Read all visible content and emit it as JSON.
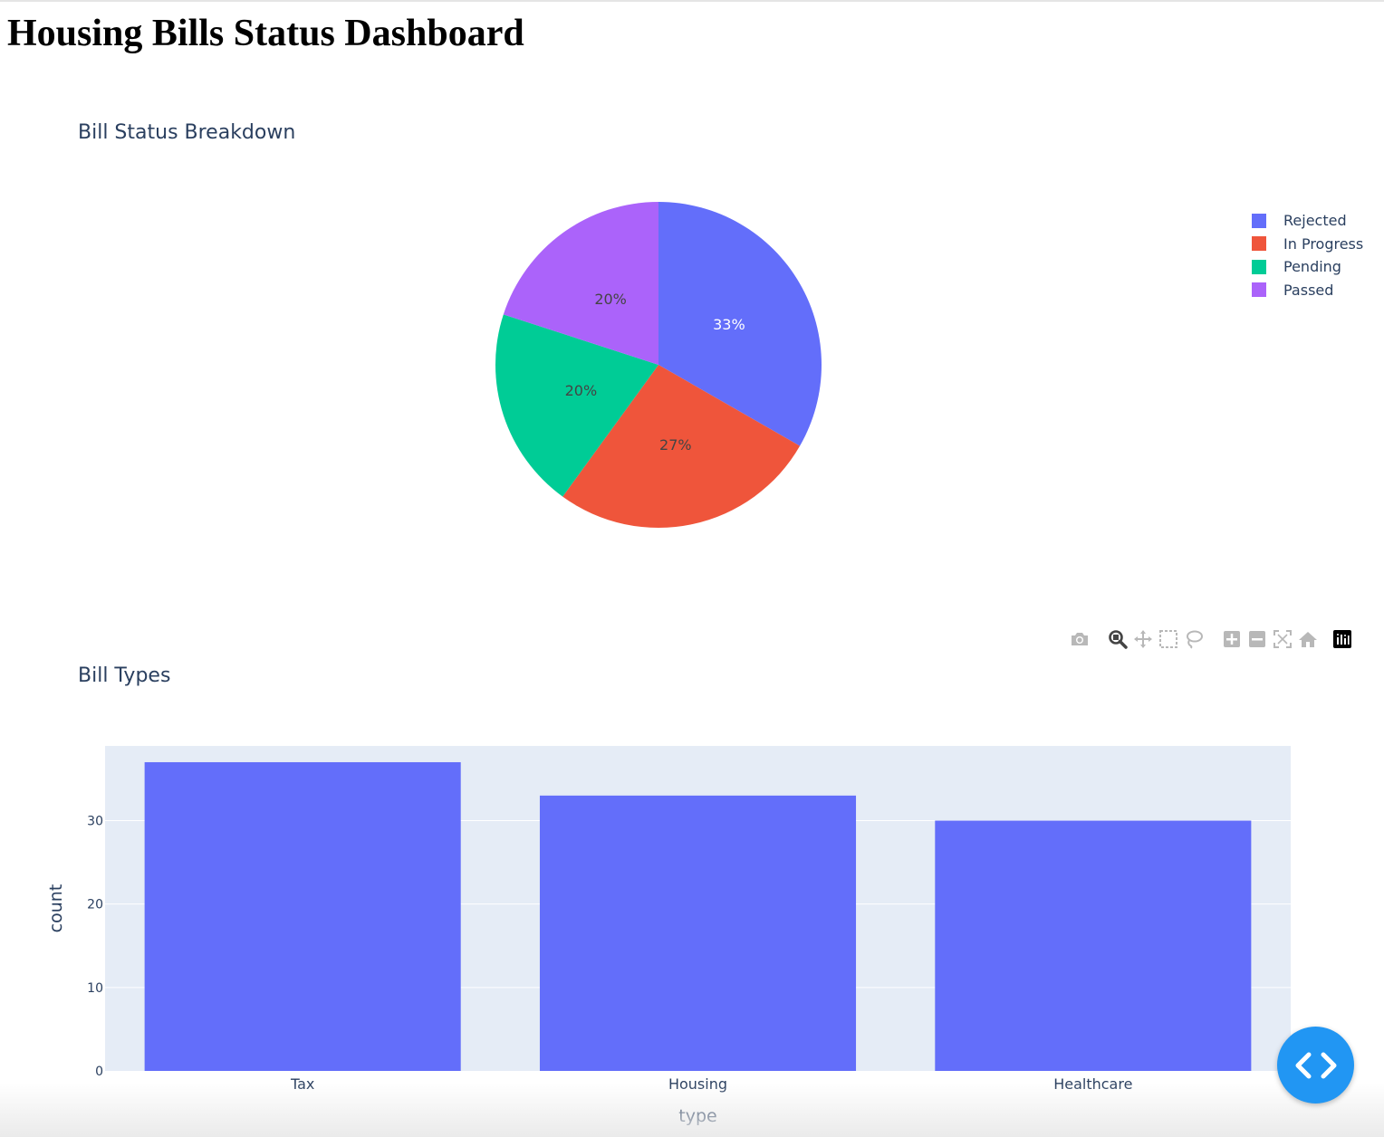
{
  "page": {
    "title": "Housing Bills Status Dashboard"
  },
  "colors": {
    "plot_bg": "#e5ecf6",
    "title_text": "#2a3f5f",
    "bar": "#636efa",
    "fab": "#2196f3"
  },
  "modebar": {
    "icons": [
      "camera-icon",
      "zoom-icon",
      "pan-icon",
      "box-select-icon",
      "lasso-select-icon",
      "zoom-in-icon",
      "zoom-out-icon",
      "autoscale-icon",
      "reset-axes-icon",
      "plotly-logo-icon"
    ]
  },
  "fab": {
    "icon": "code-icon"
  },
  "chart_data": [
    {
      "type": "pie",
      "title": "Bill Status Breakdown",
      "labels": [
        "Rejected",
        "In Progress",
        "Pending",
        "Passed"
      ],
      "values": [
        33.3,
        26.7,
        20,
        20
      ],
      "text_labels": [
        "33%",
        "27%",
        "20%",
        "20%"
      ],
      "colors": [
        "#636efa",
        "#ef553b",
        "#00cc96",
        "#ab63fa"
      ],
      "legend_position": "top-right"
    },
    {
      "type": "bar",
      "title": "Bill Types",
      "categories": [
        "Tax",
        "Housing",
        "Healthcare"
      ],
      "values": [
        37,
        33,
        30
      ],
      "xlabel": "type",
      "ylabel": "count",
      "yticks": [
        0,
        10,
        20,
        30
      ],
      "ylim": [
        0,
        38.95
      ],
      "grid": true
    }
  ]
}
